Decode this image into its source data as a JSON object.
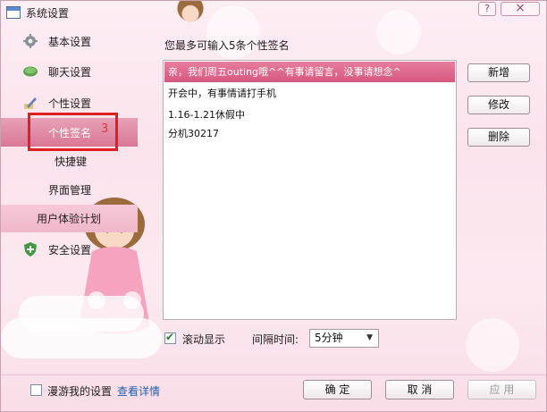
{
  "window": {
    "title": "系统设置",
    "help_label": "?",
    "close_label": "×"
  },
  "sidebar": {
    "items": [
      {
        "label": "基本设置",
        "icon": "gear-icon"
      },
      {
        "label": "聊天设置",
        "icon": "chat-bubble-icon"
      },
      {
        "label": "个性设置",
        "icon": "pencil-icon"
      },
      {
        "label": "个性签名"
      },
      {
        "label": "快捷键"
      },
      {
        "label": "界面管理"
      },
      {
        "label": "用户体验计划"
      },
      {
        "label": "安全设置",
        "icon": "shield-plus-icon"
      }
    ],
    "annotation_number": "3"
  },
  "main": {
    "prompt": "您最多可输入5条个性签名",
    "signatures": [
      "亲，我们周五outing哦^^有事请留言，没事请想念^",
      "开会中，有事情请打手机",
      "1.16-1.21休假中",
      "分机30217"
    ],
    "buttons": {
      "add": "新增",
      "edit": "修改",
      "delete": "删除"
    },
    "scroll_display": {
      "label": "滚动显示",
      "checked": true
    },
    "interval": {
      "label": "间隔时间:",
      "value": "5分钟"
    }
  },
  "footer": {
    "roaming_label": "漫游我的设置",
    "details_link": "查看详情",
    "ok": "确 定",
    "cancel": "取 消",
    "apply": "应 用"
  },
  "colors": {
    "selected_nav": "#d97796",
    "selected_row": "#d65880",
    "highlight_box": "#e02020",
    "link": "#1f5fb0"
  }
}
